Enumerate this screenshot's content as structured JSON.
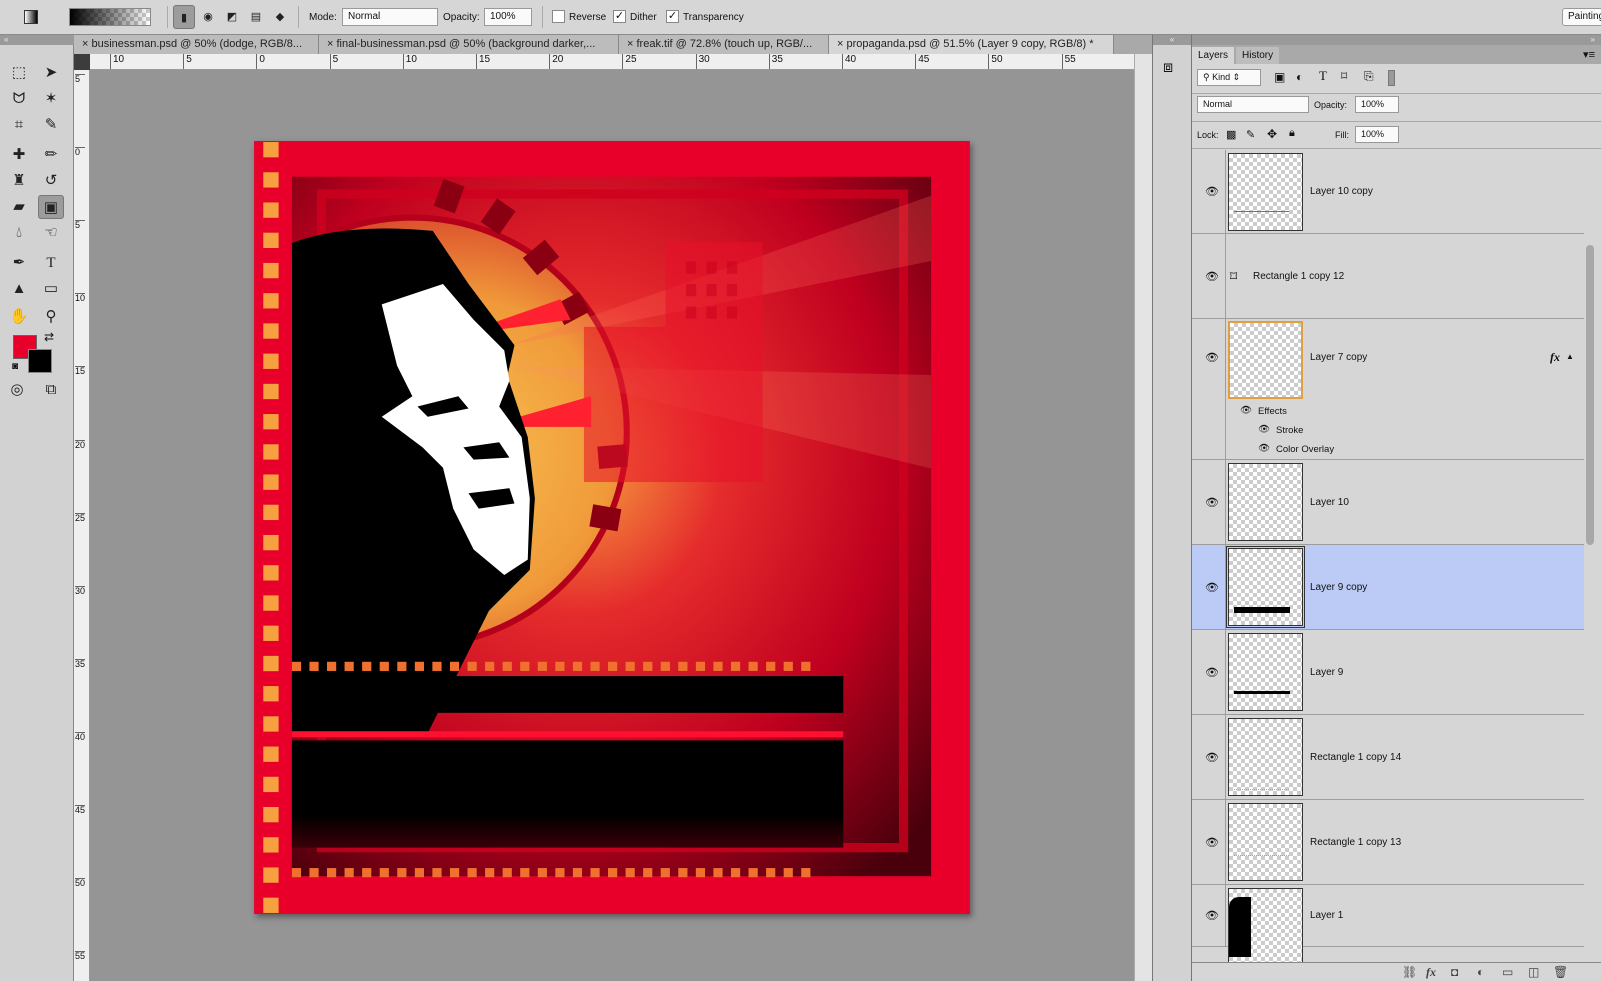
{
  "options_bar": {
    "mode_label": "Mode:",
    "mode_value": "Normal",
    "opacity_label": "Opacity:",
    "opacity_value": "100%",
    "reverse_label": "Reverse",
    "reverse_checked": false,
    "dither_label": "Dither",
    "dither_checked": true,
    "transparency_label": "Transparency",
    "transparency_checked": true,
    "workspace": "Painting"
  },
  "tabs": [
    {
      "label": "businessman.psd @ 50% (dodge, RGB/8...",
      "active": false
    },
    {
      "label": "final-businessman.psd @ 50% (background darker,...",
      "active": false
    },
    {
      "label": "freak.tif @ 72.8% (touch up, RGB/...",
      "active": false
    },
    {
      "label": "propaganda.psd @ 51.5% (Layer 9 copy, RGB/8) *",
      "active": true
    }
  ],
  "tab_close": "×",
  "ruler_top": [
    "10",
    "5",
    "0",
    "5",
    "10",
    "15",
    "20",
    "25",
    "30",
    "35",
    "40",
    "45",
    "50",
    "55"
  ],
  "ruler_left": [
    "5",
    "0",
    "5",
    "10",
    "15",
    "20",
    "25",
    "30",
    "35",
    "40",
    "45",
    "50",
    "55"
  ],
  "colors": {
    "foreground": "#e8002a",
    "background": "#000000",
    "accent": "#bccbf5"
  },
  "layers_panel": {
    "tabs": [
      "Layers",
      "History"
    ],
    "filter_kind": "Kind",
    "blend_mode": "Normal",
    "opacity_label": "Opacity:",
    "opacity_value": "100%",
    "lock_label": "Lock:",
    "fill_label": "Fill:",
    "fill_value": "100%",
    "layers": [
      {
        "name": "Layer 10 copy",
        "visible": true,
        "selected": false
      },
      {
        "name": "Rectangle 1 copy 12",
        "visible": true,
        "selected": false
      },
      {
        "name": "Layer 7 copy",
        "visible": true,
        "selected": false,
        "fx": "fx"
      },
      {
        "name": "Layer 10",
        "visible": true,
        "selected": false
      },
      {
        "name": "Layer 9 copy",
        "visible": true,
        "selected": true
      },
      {
        "name": "Layer 9",
        "visible": true,
        "selected": false
      },
      {
        "name": "Rectangle 1 copy 14",
        "visible": true,
        "selected": false
      },
      {
        "name": "Rectangle 1 copy 13",
        "visible": true,
        "selected": false
      },
      {
        "name": "Layer 1",
        "visible": true,
        "selected": false
      }
    ],
    "effects": {
      "title": "Effects",
      "items": [
        "Stroke",
        "Color Overlay"
      ]
    }
  }
}
